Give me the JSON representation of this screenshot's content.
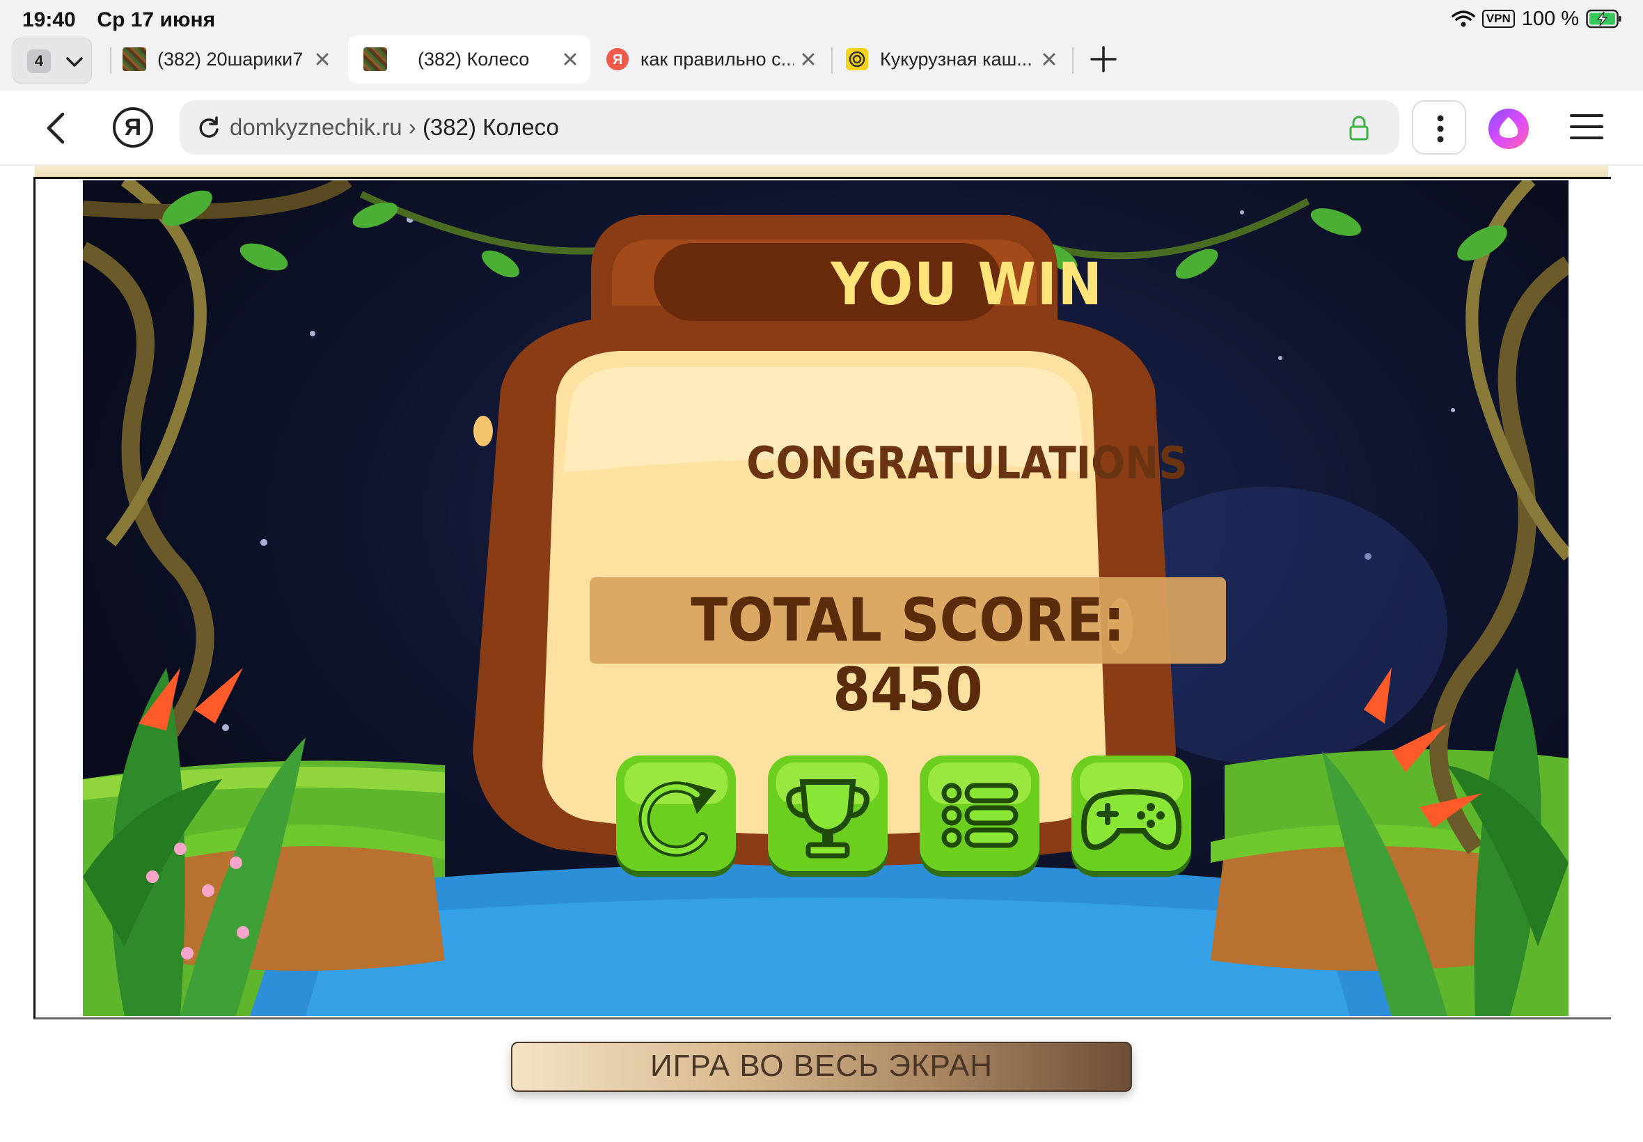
{
  "status_bar": {
    "time": "19:40",
    "date": "Ср 17 июня",
    "vpn": "VPN",
    "battery": "100 %"
  },
  "tab_strip": {
    "tab_count": "4",
    "tabs": [
      {
        "title": "(382) 20шарики7",
        "active": false
      },
      {
        "title": "(382) Колесо",
        "active": true
      },
      {
        "title": "как правильно с...",
        "active": false
      },
      {
        "title": "Кукурузная каш...",
        "active": false
      }
    ]
  },
  "address_bar": {
    "domain": "domkyznechik.ru",
    "separator": " › ",
    "page_title": "(382) Колесо"
  },
  "game": {
    "heading": "YOU WIN",
    "subheading": "CONGRATULATIONS",
    "score_label": "TOTAL SCORE: 8450",
    "buttons": [
      "restart-icon",
      "trophy-icon",
      "list-icon",
      "gamepad-icon"
    ]
  },
  "page": {
    "fullscreen_button": "ИГРА ВО ВЕСЬ ЭКРАН"
  },
  "colors": {
    "accent_green": "#6ccf1f",
    "panel_wood": "#8a3c14",
    "panel_cream": "#fde1a0",
    "title_yellow": "#ffe47a"
  }
}
